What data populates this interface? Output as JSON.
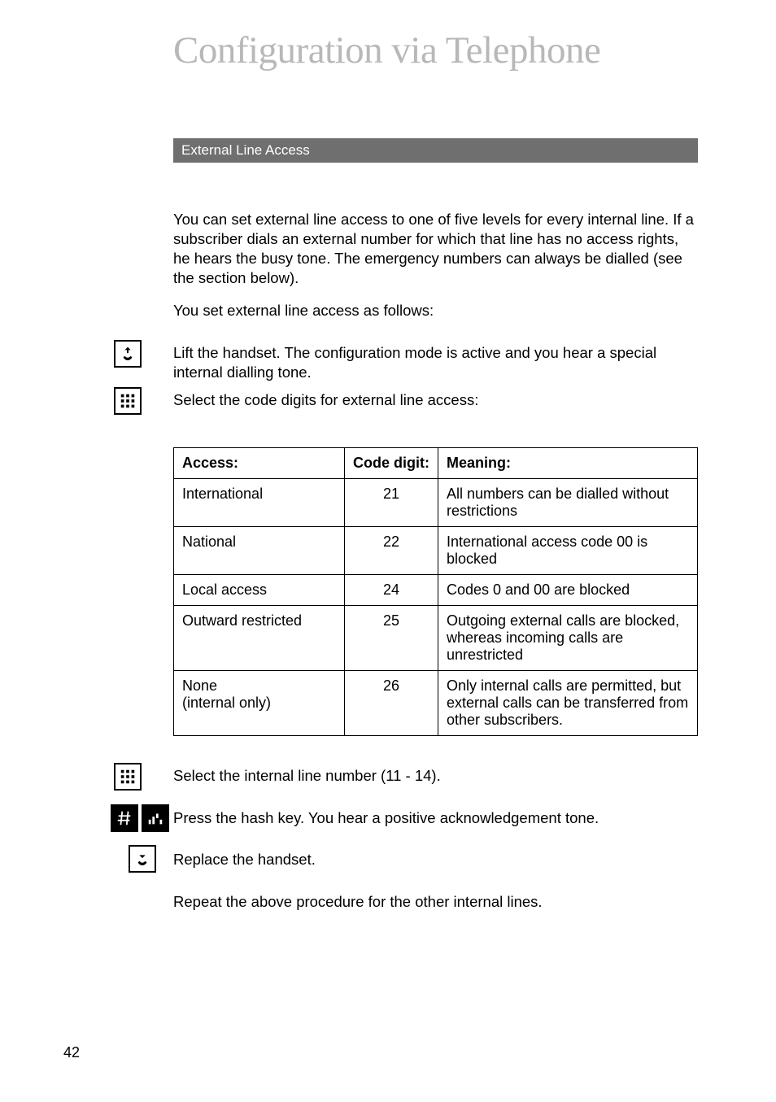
{
  "header": {
    "title": "Configuration via Telephone"
  },
  "section": {
    "title": "External Line Access"
  },
  "body": {
    "p1": "You can set external line access to one of five levels for every internal line. If a subscriber dials an external number for which that line has no access rights, he hears the busy tone. The emergency numbers can always be dialled (see the section below).",
    "p2": "You set external line access as follows:",
    "s1": "Lift the handset. The configuration mode is active and you hear a special internal dialling tone.",
    "s2": "Select the code digits for external line access:",
    "s3": "Select the internal line number (11 - 14).",
    "s4": "Press the hash key. You hear a positive acknowledgement tone.",
    "s5": "Replace the handset.",
    "s6": "Repeat the above procedure for the other internal lines."
  },
  "table": {
    "headers": {
      "access": "Access:",
      "code": "Code digit:",
      "meaning": "Meaning:"
    },
    "rows": [
      {
        "access": "International",
        "code": "21",
        "meaning": "All numbers can be dialled without restrictions"
      },
      {
        "access": "National",
        "code": "22",
        "meaning": "International access code 00 is blocked"
      },
      {
        "access": "Local access",
        "code": "24",
        "meaning": "Codes 0 and 00 are blocked"
      },
      {
        "access": "Outward restricted",
        "code": "25",
        "meaning": "Outgoing external calls are blocked, whereas incoming calls are unrestricted"
      },
      {
        "access": "None\n(internal only)",
        "code": "26",
        "meaning": "Only internal calls are permitted, but external calls can be transferred from other subscribers."
      }
    ]
  },
  "page_number": "42"
}
